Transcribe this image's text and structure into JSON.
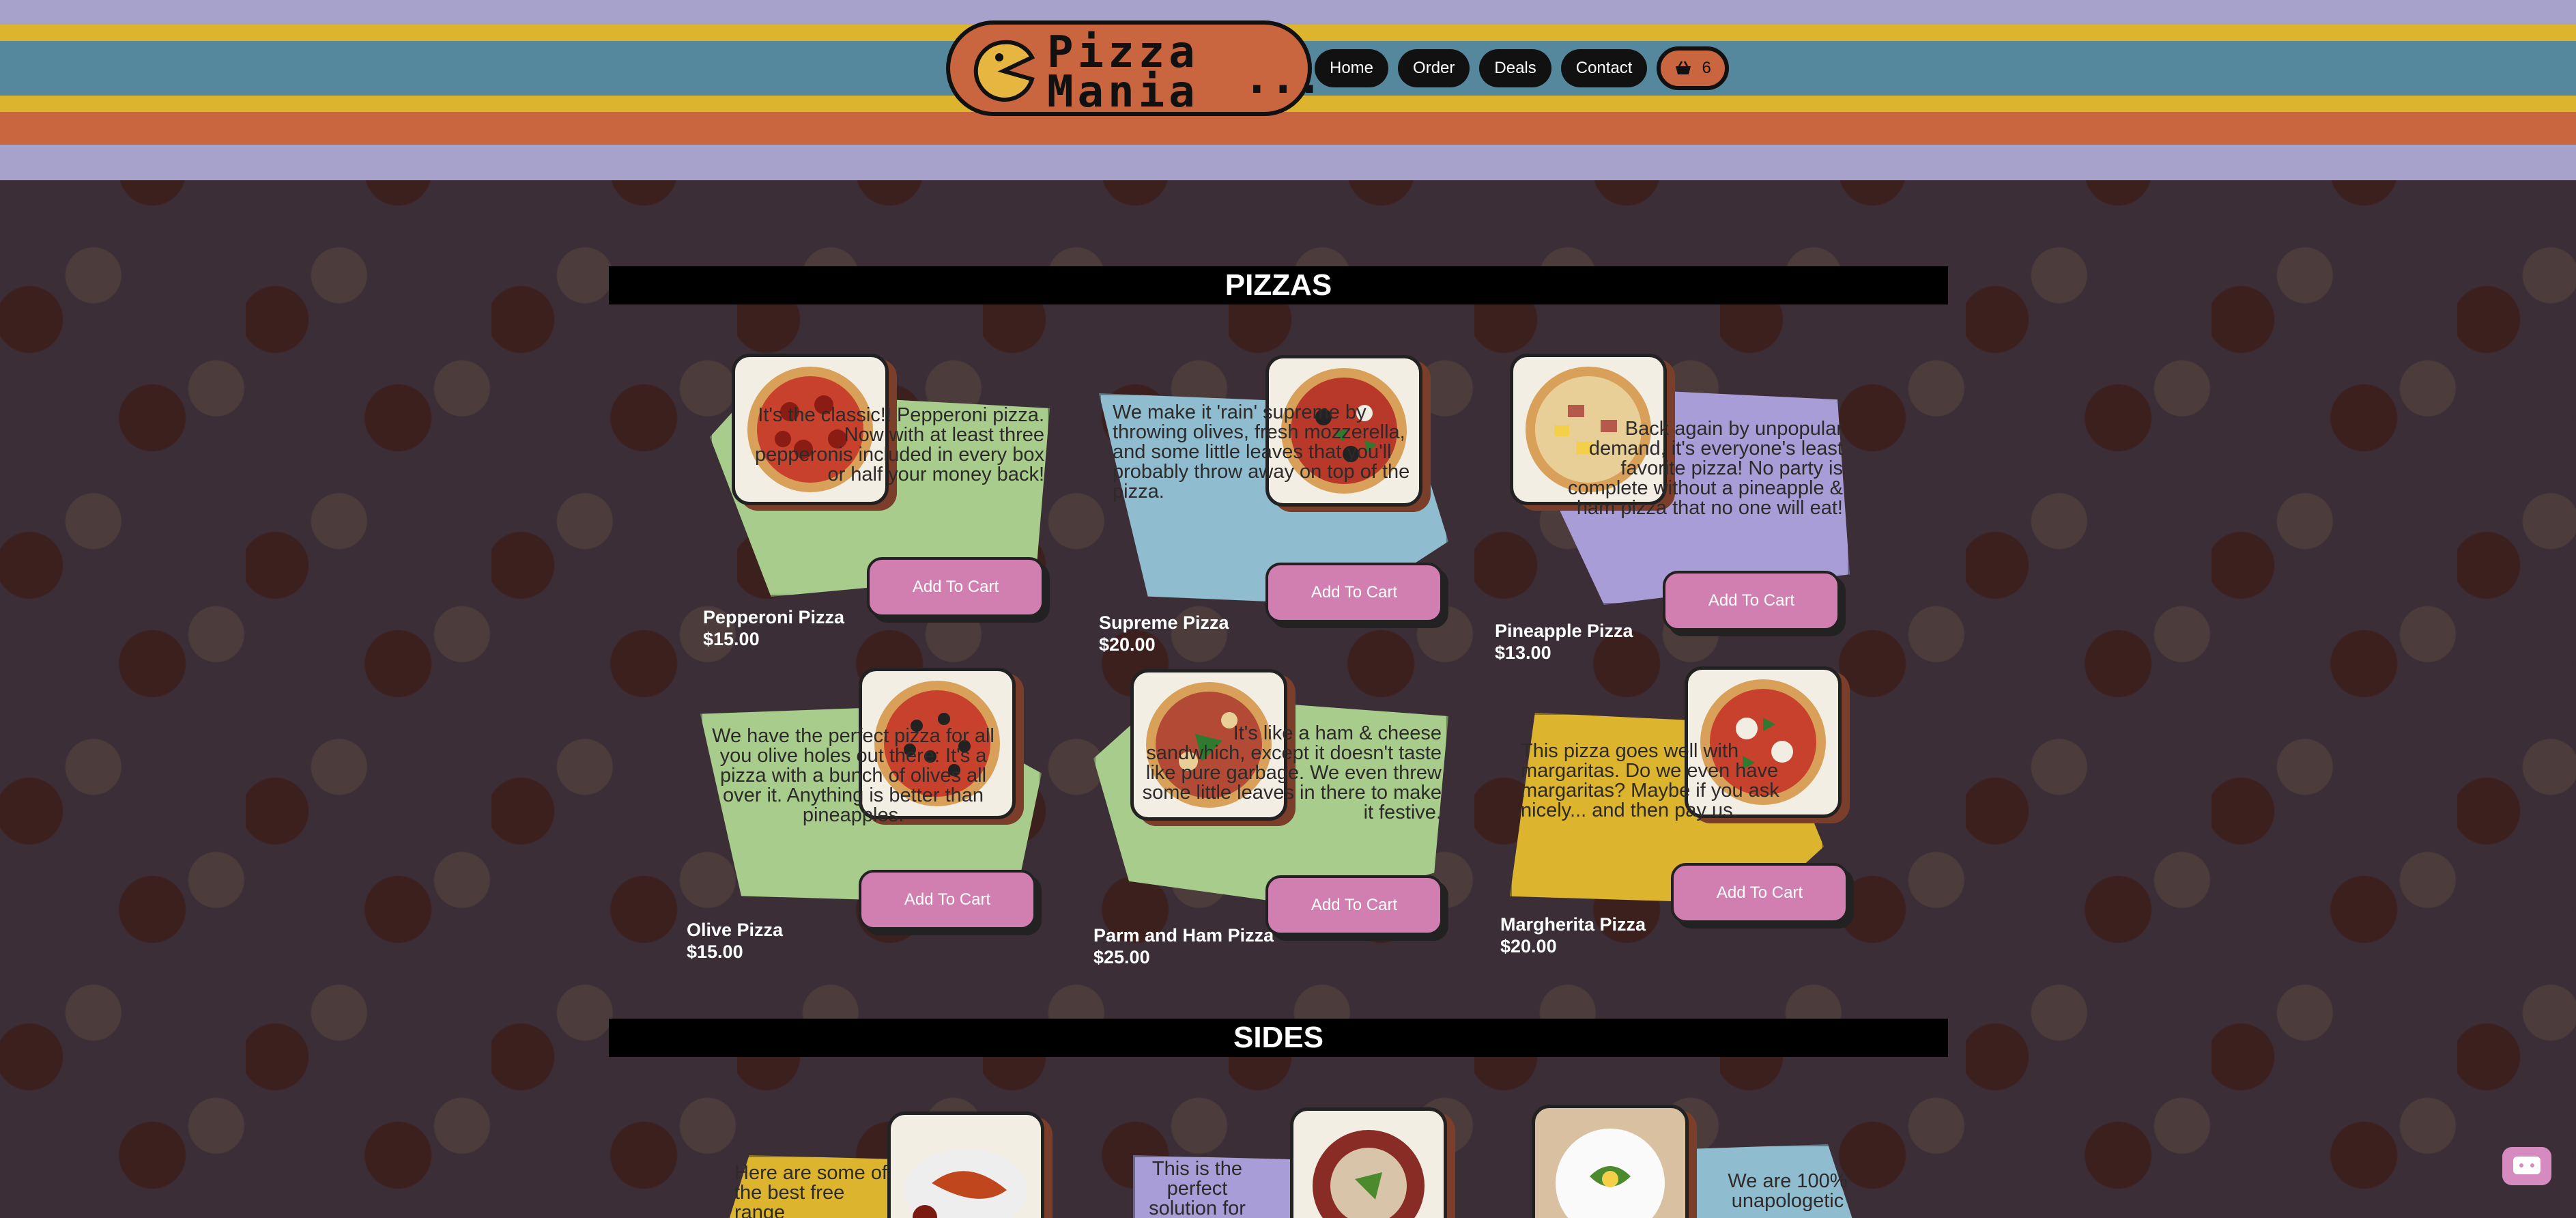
{
  "logo": {
    "line1": "Pizza",
    "line2": "Mania",
    "dots": "..."
  },
  "nav": {
    "items": [
      {
        "label": "Home"
      },
      {
        "label": "Order"
      },
      {
        "label": "Deals"
      },
      {
        "label": "Contact"
      }
    ],
    "cart_count": "6"
  },
  "sections": {
    "pizzas_title": "PIZZAS",
    "sides_title": "SIDES"
  },
  "add_to_cart_label": "Add To Cart",
  "pizzas": [
    {
      "name": "Pepperoni Pizza",
      "price": "$15.00",
      "description": "It's the classic!! Pepperoni pizza. Now with at least three pepperonis included in every box or half your money back!"
    },
    {
      "name": "Supreme Pizza",
      "price": "$20.00",
      "description": "We make it 'rain' supreme by throwing olives, fresh mozzerella, and some little leaves that you'll probably throw away on top of the pizza."
    },
    {
      "name": "Pineapple Pizza",
      "price": "$13.00",
      "description": "Back again by unpopular demand, it's everyone's least favorite pizza! No party is complete without a pineapple & ham pizza that no one will eat!"
    },
    {
      "name": "Olive Pizza",
      "price": "$15.00",
      "description": "We have the perfect pizza for all you olive holes out there: It's a pizza with a bunch of olives all over it. Anything is better than pineapples."
    },
    {
      "name": "Parm and Ham Pizza",
      "price": "$25.00",
      "description": "It's like a ham & cheese sandwhich, except it doesn't taste like pure garbage. We even threw some little leaves in there to make it festive."
    },
    {
      "name": "Margherita Pizza",
      "price": "$20.00",
      "description": "This pizza goes well with margaritas. Do we even have margaritas? Maybe if you ask nicely... and then pay us."
    }
  ],
  "sides": [
    {
      "description": "Here are some of the best free range"
    },
    {
      "description": "This is the perfect solution for"
    },
    {
      "description": "We are 100% unapologetic"
    }
  ],
  "colors": {
    "lavender": "#a7a2cc",
    "mustard": "#dcb42e",
    "teal": "#55889c",
    "orange": "#c9653f",
    "green": "#a8cc8c",
    "blue": "#8fbccf",
    "purple": "#a89dd6",
    "pink_button": "#d17fb1",
    "background": "#3b2e36"
  },
  "icons": {
    "logo": "pacman-pizza-icon",
    "cart": "basket-icon",
    "chat": "chat-bubble-icon"
  }
}
